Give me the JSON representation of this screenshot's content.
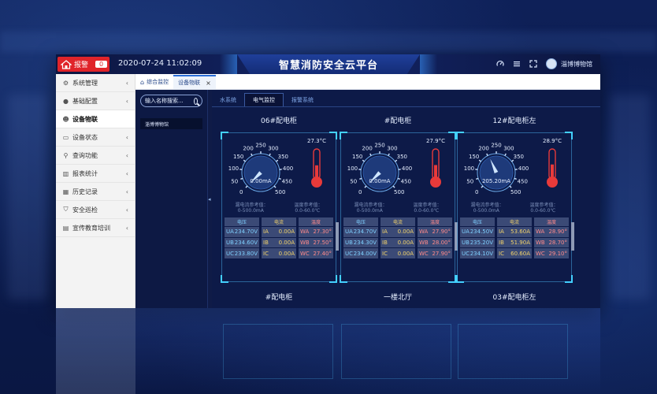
{
  "header": {
    "alarm_label": "报警",
    "alarm_count": "0",
    "datetime": "2020-07-24 11:02:09",
    "title": "智慧消防安全云平台",
    "user_name": "淄博博物馆"
  },
  "sidebar": {
    "items": [
      {
        "label": "系统管理",
        "icon": "gear-icon"
      },
      {
        "label": "基础配置",
        "icon": "user-icon"
      },
      {
        "label": "设备物联",
        "icon": "users-icon"
      },
      {
        "label": "设备状态",
        "icon": "monitor-icon"
      },
      {
        "label": "查询功能",
        "icon": "search-icon"
      },
      {
        "label": "报表统计",
        "icon": "chart-icon"
      },
      {
        "label": "历史记录",
        "icon": "calendar-icon"
      },
      {
        "label": "安全巡检",
        "icon": "shield-icon"
      },
      {
        "label": "宣传教育培训",
        "icon": "book-icon"
      }
    ]
  },
  "tabs": [
    {
      "label": "综合监控"
    },
    {
      "label": "设备物联"
    }
  ],
  "devlist": {
    "search_placeholder": "输入名称搜索...",
    "items": [
      "淄博博物馆"
    ]
  },
  "subtabs": [
    "水系统",
    "电气监控",
    "报警系统"
  ],
  "cards": [
    {
      "title": "06#配电柜",
      "footer": "#配电柜",
      "current": "0.00mA",
      "gauge_value_ma": 0,
      "temperature": "27.3°C",
      "temp_level": 0.45,
      "leak_ref_label": "漏电流参考值：",
      "leak_ref_value": "0-500.0mA",
      "temp_ref_label": "温度参考值：",
      "temp_ref_value": "0.0-60.0℃",
      "headers": [
        "电压",
        "电流",
        "温度"
      ],
      "volt": [
        [
          "UA",
          "234.70V"
        ],
        [
          "UB",
          "234.60V"
        ],
        [
          "UC",
          "233.80V"
        ]
      ],
      "curr": [
        [
          "IA",
          "0.00A"
        ],
        [
          "IB",
          "0.00A"
        ],
        [
          "IC",
          "0.00A"
        ]
      ],
      "temp": [
        [
          "WA",
          "27.30°"
        ],
        [
          "WB",
          "27.50°"
        ],
        [
          "WC",
          "27.40°"
        ]
      ]
    },
    {
      "title": "#配电柜",
      "footer": "一楼北厅",
      "current": "0.00mA",
      "gauge_value_ma": 0,
      "temperature": "27.9°C",
      "temp_level": 0.46,
      "leak_ref_label": "漏电流参考值：",
      "leak_ref_value": "0-500.0mA",
      "temp_ref_label": "温度参考值：",
      "temp_ref_value": "0.0-60.0℃",
      "headers": [
        "电压",
        "电流",
        "温度"
      ],
      "volt": [
        [
          "UA",
          "234.70V"
        ],
        [
          "UB",
          "234.30V"
        ],
        [
          "UC",
          "234.00V"
        ]
      ],
      "curr": [
        [
          "IA",
          "0.00A"
        ],
        [
          "IB",
          "0.00A"
        ],
        [
          "IC",
          "0.00A"
        ]
      ],
      "temp": [
        [
          "WA",
          "27.90°"
        ],
        [
          "WB",
          "28.00°"
        ],
        [
          "WC",
          "27.90°"
        ]
      ]
    },
    {
      "title": "12#配电柜左",
      "footer": "03#配电柜左",
      "current": "205.20mA",
      "gauge_value_ma": 205.2,
      "temperature": "28.9°C",
      "temp_level": 0.48,
      "leak_ref_label": "漏电流参考值：",
      "leak_ref_value": "0-500.0mA",
      "temp_ref_label": "温度参考值：",
      "temp_ref_value": "0.0-60.0℃",
      "headers": [
        "电压",
        "电流",
        "温度"
      ],
      "volt": [
        [
          "UA",
          "234.50V"
        ],
        [
          "UB",
          "235.20V"
        ],
        [
          "UC",
          "234.10V"
        ]
      ],
      "curr": [
        [
          "IA",
          "53.60A"
        ],
        [
          "IB",
          "51.90A"
        ],
        [
          "IC",
          "60.60A"
        ]
      ],
      "temp": [
        [
          "WA",
          "28.90°"
        ],
        [
          "WB",
          "28.70°"
        ],
        [
          "WC",
          "29.10°"
        ]
      ]
    }
  ],
  "gauge_scale": {
    "ticks": [
      "0",
      "50",
      "100",
      "150",
      "200",
      "250",
      "300",
      "350",
      "400",
      "450",
      "500"
    ],
    "max": 500
  },
  "colors": {
    "alarm": "#e0242a",
    "accent": "#43d0ff",
    "volt": "#7fd0ff",
    "curr": "#f3d36a",
    "temp": "#ff8a8a",
    "thermo": "#e83a3a"
  }
}
